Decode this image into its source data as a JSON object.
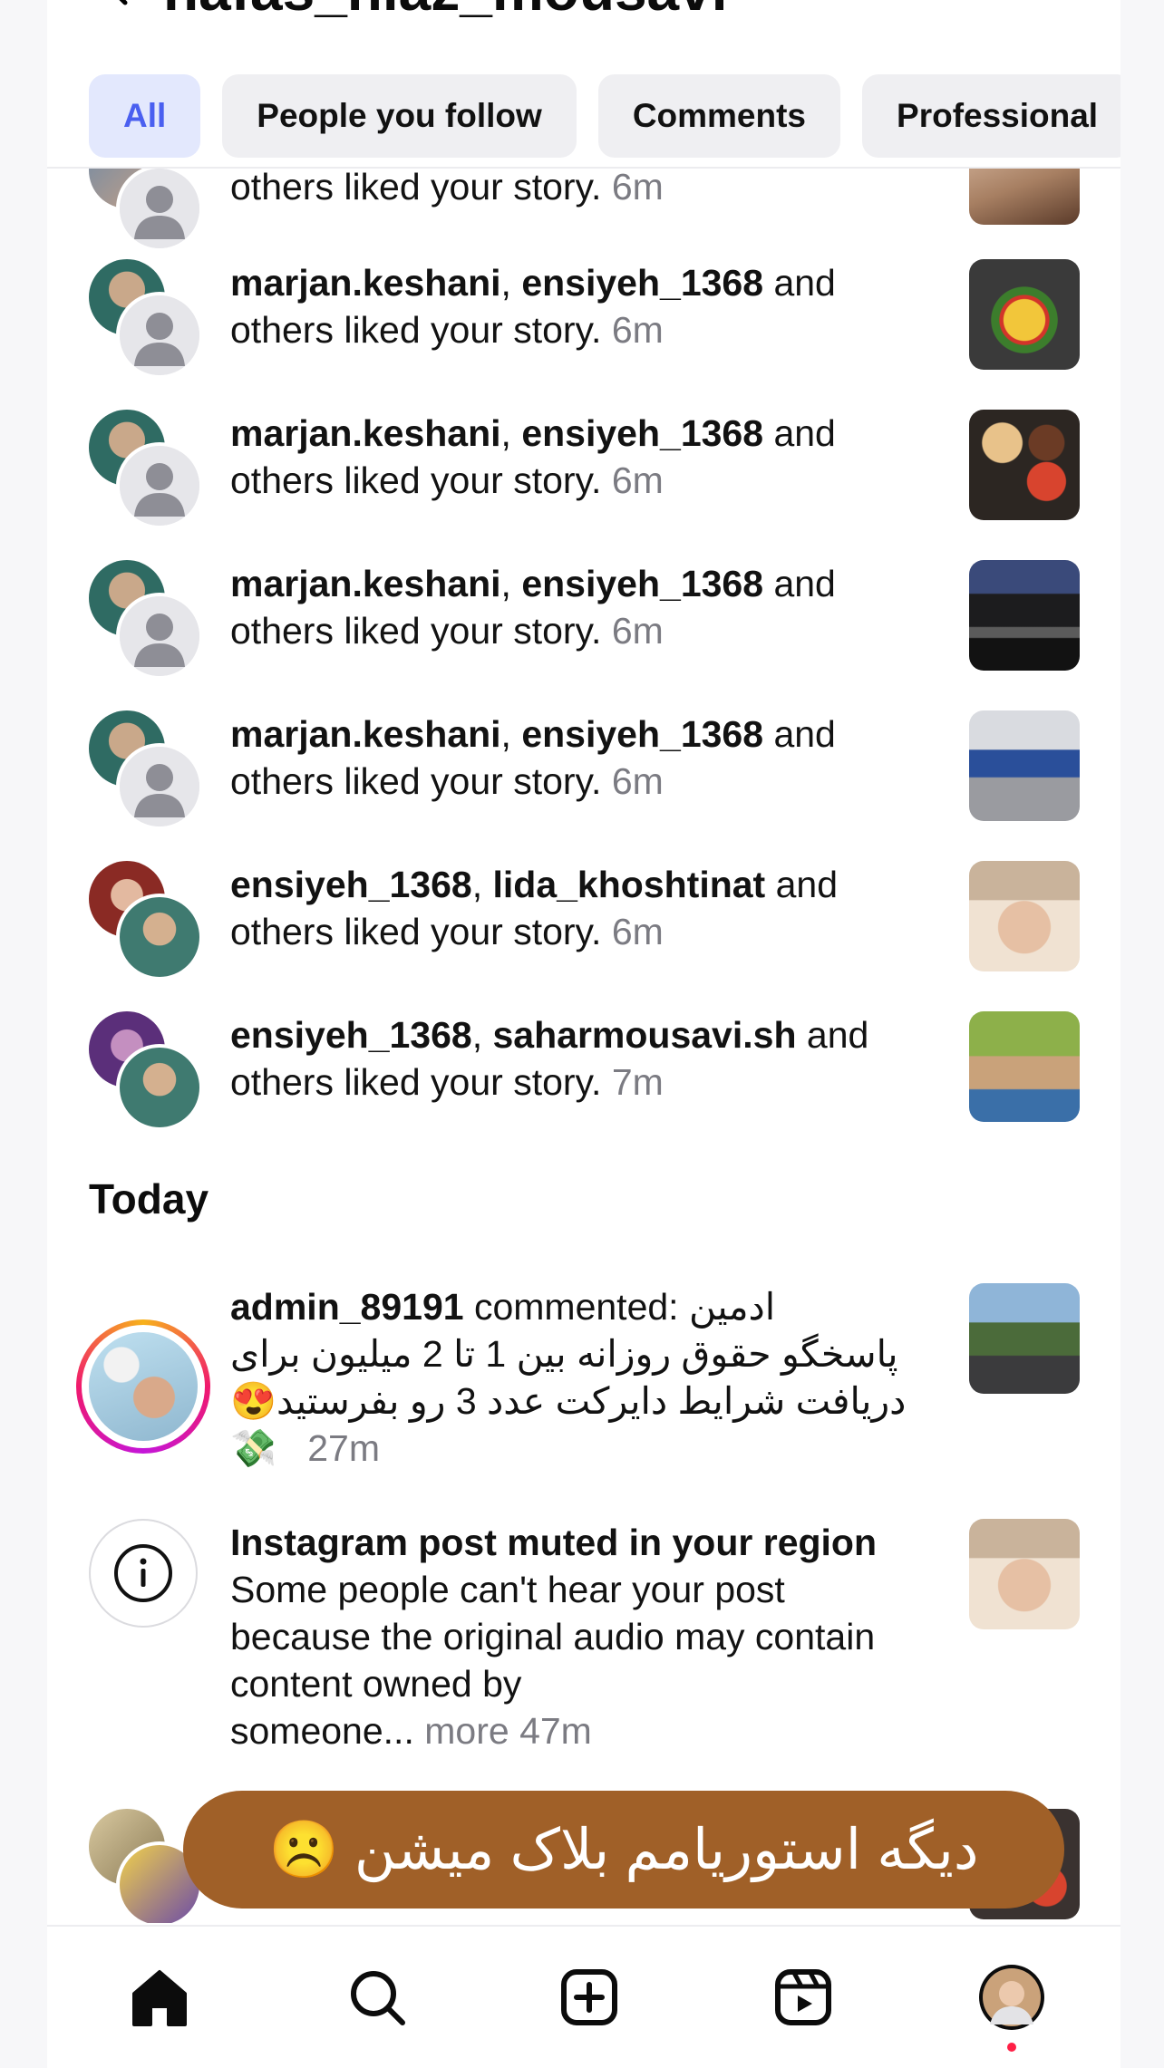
{
  "header": {
    "back_icon": "chevron-left-icon",
    "username": "nafas_niaz_mousavi"
  },
  "filters": [
    {
      "label": "All",
      "active": true
    },
    {
      "label": "People you follow",
      "active": false
    },
    {
      "label": "Comments",
      "active": false
    },
    {
      "label": "Professional",
      "active": false
    }
  ],
  "notifications": [
    {
      "users": [
        "",
        ""
      ],
      "suffix": "others liked your story.",
      "time": "6m"
    },
    {
      "users": [
        "marjan.keshani",
        "ensiyeh_1368"
      ],
      "and": "and",
      "suffix": "others liked your story.",
      "time": "6m"
    },
    {
      "users": [
        "marjan.keshani",
        "ensiyeh_1368"
      ],
      "and": "and",
      "suffix": "others liked your story.",
      "time": "6m"
    },
    {
      "users": [
        "marjan.keshani",
        "ensiyeh_1368"
      ],
      "and": "and",
      "suffix": "others liked your story.",
      "time": "6m"
    },
    {
      "users": [
        "marjan.keshani",
        "ensiyeh_1368"
      ],
      "and": "and",
      "suffix": "others liked your story.",
      "time": "6m"
    },
    {
      "users": [
        "ensiyeh_1368",
        "lida_khoshtinat"
      ],
      "and": "and",
      "suffix": "others liked your story.",
      "time": "6m"
    },
    {
      "users": [
        "ensiyeh_1368",
        "saharmousavi.sh"
      ],
      "and": "and",
      "suffix": "others liked your story.",
      "time": "7m"
    }
  ],
  "today": {
    "title": "Today",
    "comment": {
      "user": "admin_89191",
      "action": "commented:",
      "line1": "ادمین",
      "line2": "پاسخگو حقوق روزانه بین 1 تا 2 میلیون برای",
      "line3": "دریافت شرایط دایرکت عدد 3 رو بفرستید😍",
      "money": "💸",
      "time": "27m"
    },
    "muted": {
      "title": "Instagram post muted in your region",
      "body1": "Some people can't hear your post",
      "body2": "because the original audio may contain",
      "body3": "content owned by",
      "body4": "someone...",
      "more": "more",
      "time": "47m"
    }
  },
  "sticker": {
    "text": "دیگه استوریامم بلاک میشن ☹️"
  },
  "bottom_nav": [
    {
      "icon": "home-icon"
    },
    {
      "icon": "search-icon"
    },
    {
      "icon": "create-icon"
    },
    {
      "icon": "reels-icon"
    },
    {
      "icon": "profile-avatar"
    }
  ],
  "colors": {
    "active_chip_bg": "#e3e8fd",
    "active_chip_text": "#4a5ff0",
    "sticker_bg": "#a06028",
    "muted_time": "#7b7b82"
  }
}
